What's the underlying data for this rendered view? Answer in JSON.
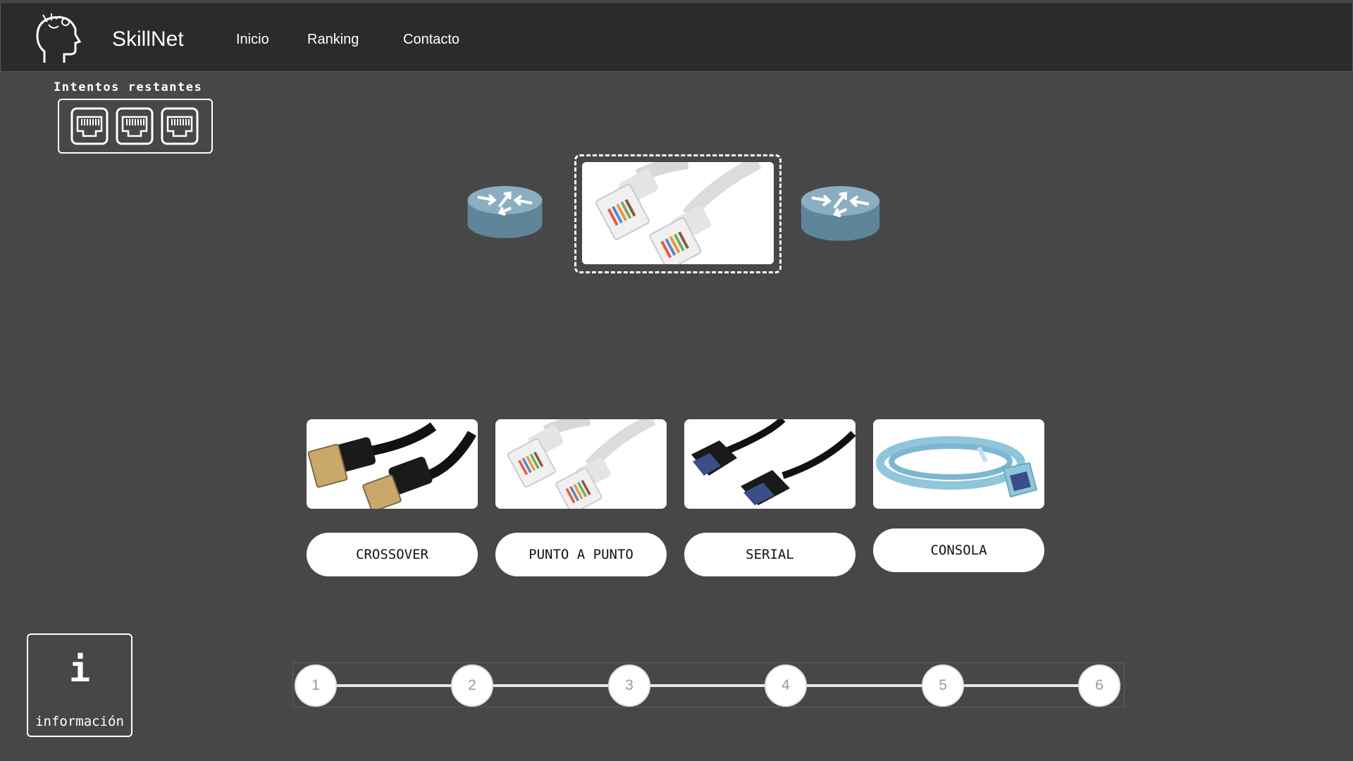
{
  "app": {
    "brand": "SkillNet"
  },
  "nav": {
    "items": [
      {
        "label": "Inicio"
      },
      {
        "label": "Ranking"
      },
      {
        "label": "Contacto"
      }
    ]
  },
  "attempts": {
    "label": "Intentos restantes",
    "remaining": 3,
    "icon": "ethernet-port-icon"
  },
  "topology": {
    "left_device": "router-icon",
    "right_device": "router-icon",
    "slot_cable": "straight-through-cable-image"
  },
  "options": [
    {
      "label": "CROSSOVER",
      "image": "crossover-cable-image"
    },
    {
      "label": "PUNTO A PUNTO",
      "image": "straight-through-cable-image"
    },
    {
      "label": "SERIAL",
      "image": "serial-cable-image"
    },
    {
      "label": "CONSOLA",
      "image": "console-cable-image"
    }
  ],
  "info": {
    "icon": "i",
    "label": "información"
  },
  "progress": {
    "steps": [
      "1",
      "2",
      "3",
      "4",
      "5",
      "6"
    ]
  },
  "colors": {
    "background": "#474747",
    "navbar": "#2b2b2b",
    "router": "#6f95a8",
    "console_cable": "#8fc6dc"
  }
}
